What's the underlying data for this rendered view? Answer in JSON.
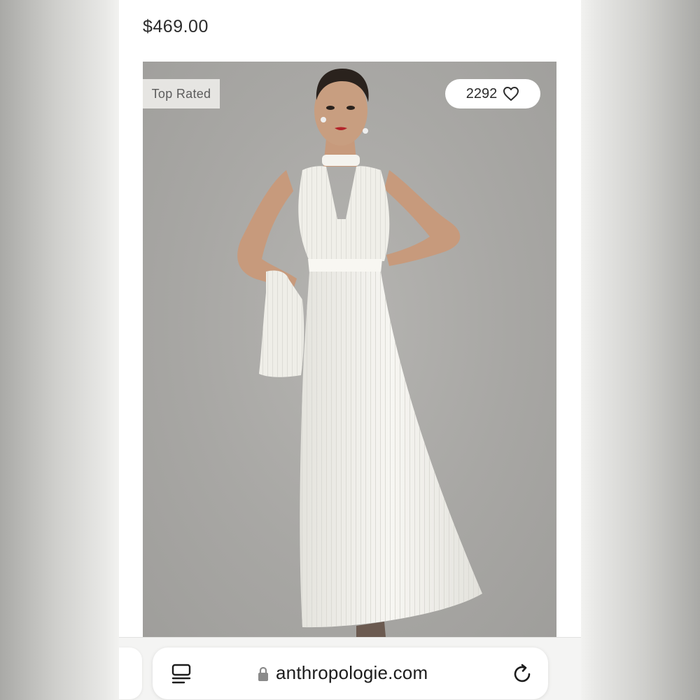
{
  "product": {
    "price": "$469.00",
    "badge": "Top Rated",
    "likes_count": "2292",
    "image_alt": "Model wearing a white pleated halter maxi dress",
    "image_icon": "dress-photo"
  },
  "browser": {
    "url": "anthropologie.com",
    "reader_icon": "reader-mode-icon",
    "lock_icon": "lock-icon",
    "reload_icon": "reload-icon"
  },
  "colors": {
    "photo_background": "#a8a7a4",
    "dress": "#f2f1ec",
    "badge_background": "#e6e5e2",
    "pill_background": "#ffffff",
    "toolbar_background": "#f4f4f3"
  }
}
